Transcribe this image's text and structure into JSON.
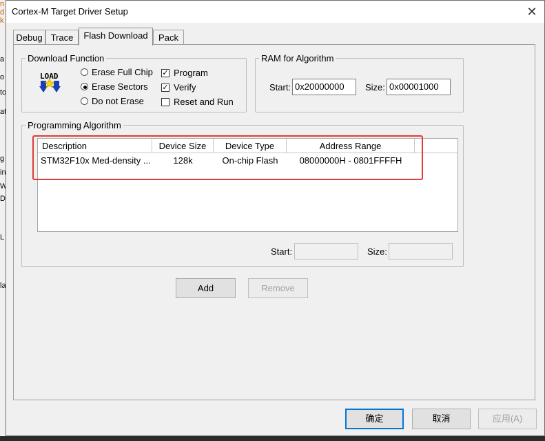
{
  "window": {
    "title": "Cortex-M Target Driver Setup",
    "close": "✕"
  },
  "tabs": [
    {
      "label": "Debug"
    },
    {
      "label": "Trace"
    },
    {
      "label": "Flash Download"
    },
    {
      "label": "Pack"
    }
  ],
  "download_function": {
    "title": "Download Function",
    "logo_text": "LOAD",
    "radios": [
      {
        "label": "Erase Full Chip",
        "selected": false
      },
      {
        "label": "Erase Sectors",
        "selected": true
      },
      {
        "label": "Do not Erase",
        "selected": false
      }
    ],
    "checks": [
      {
        "label": "Program",
        "checked": true
      },
      {
        "label": "Verify",
        "checked": true
      },
      {
        "label": "Reset and Run",
        "checked": false
      }
    ]
  },
  "ram": {
    "title": "RAM for Algorithm",
    "start_label": "Start:",
    "start_value": "0x20000000",
    "size_label": "Size:",
    "size_value": "0x00001000"
  },
  "algorithm": {
    "title": "Programming Algorithm",
    "columns": [
      "Description",
      "Device Size",
      "Device Type",
      "Address Range"
    ],
    "rows": [
      {
        "description": "STM32F10x Med-density ...",
        "device_size": "128k",
        "device_type": "On-chip Flash",
        "address_range": "08000000H - 0801FFFFH"
      }
    ],
    "start_label": "Start:",
    "start_value": "",
    "size_label": "Size:",
    "size_value": ""
  },
  "buttons": {
    "add": "Add",
    "remove": "Remove"
  },
  "footer": {
    "ok": "确定",
    "cancel": "取消",
    "apply": "应用(A)"
  },
  "background_strip": [
    "n",
    "d",
    "k",
    "a",
    "o",
    "to",
    "at",
    "g",
    "in",
    "W",
    "D",
    "L",
    "la"
  ],
  "colors": {
    "highlight": "#e53935",
    "default_button_border": "#0078d7",
    "checkmark": "✓"
  }
}
